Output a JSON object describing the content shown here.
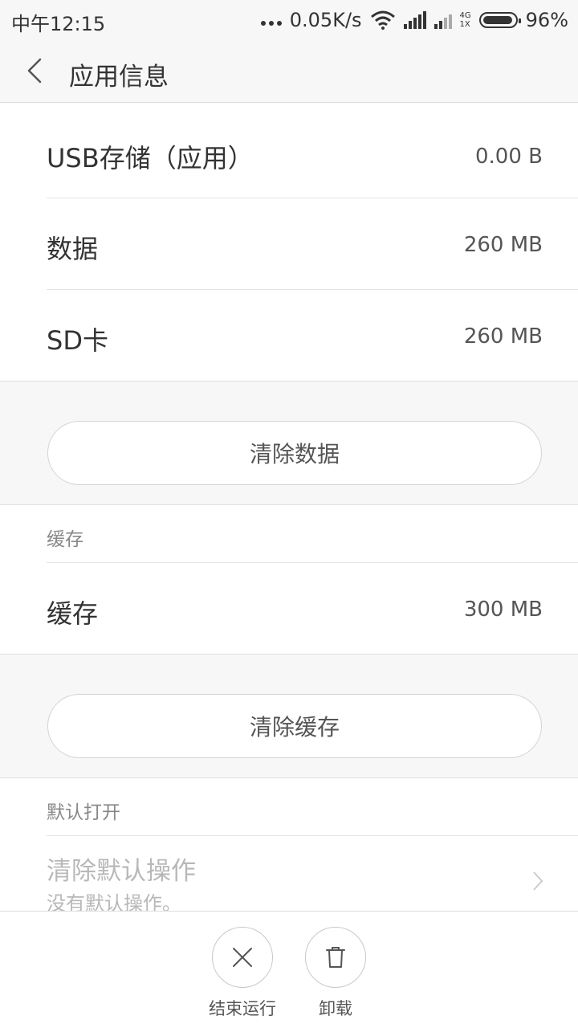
{
  "status_bar": {
    "time": "中午12:15",
    "speed": "0.05K/s",
    "network_top": "4G",
    "network_bottom": "1X",
    "battery": "96%",
    "battery_level": 0.96
  },
  "header": {
    "title": "应用信息"
  },
  "storage": {
    "rows": [
      {
        "label": "USB存储（应用）",
        "value": "0.00 B"
      },
      {
        "label": "数据",
        "value": "260 MB"
      },
      {
        "label": "SD卡",
        "value": "260 MB"
      }
    ],
    "clear_data_label": "清除数据"
  },
  "cache": {
    "section_title": "缓存",
    "row_label": "缓存",
    "row_value": "300 MB",
    "clear_cache_label": "清除缓存"
  },
  "defaults": {
    "section_title": "默认打开",
    "clear_label": "清除默认操作",
    "clear_sub": "没有默认操作。"
  },
  "bottom_actions": {
    "force_stop": "结束运行",
    "uninstall": "卸载"
  },
  "colors": {
    "background": "#ffffff",
    "panel": "#f7f7f7",
    "disabled_text": "#b8b8b8"
  }
}
